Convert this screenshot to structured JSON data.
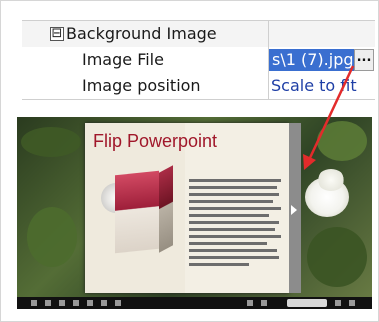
{
  "properties": {
    "group_toggle": "⊟",
    "group_label": "Background Image",
    "rows": [
      {
        "label": "Image File",
        "value": "s\\1 (7).jpg",
        "button": "..."
      },
      {
        "label": "Image position",
        "value": "Scale to fit"
      }
    ]
  },
  "preview": {
    "book_title": "Flip Powerpoint",
    "colors": {
      "accent": "#a0172a",
      "arrow": "#e32b2b",
      "selection": "#3a6fd0"
    }
  }
}
